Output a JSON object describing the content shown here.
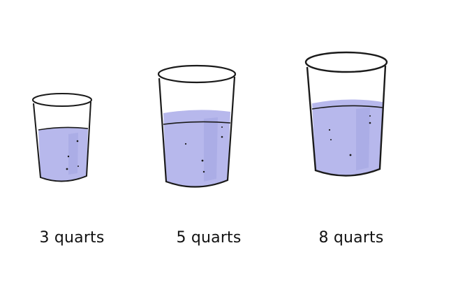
{
  "beakers": [
    {
      "label": "3 quarts"
    },
    {
      "label": "5 quarts"
    },
    {
      "label": "8 quarts"
    }
  ],
  "colors": {
    "water": "#b7b8ec",
    "water_shade": "#9d9fe0",
    "outline": "#1a1a1a",
    "glass": "#ffffff"
  }
}
